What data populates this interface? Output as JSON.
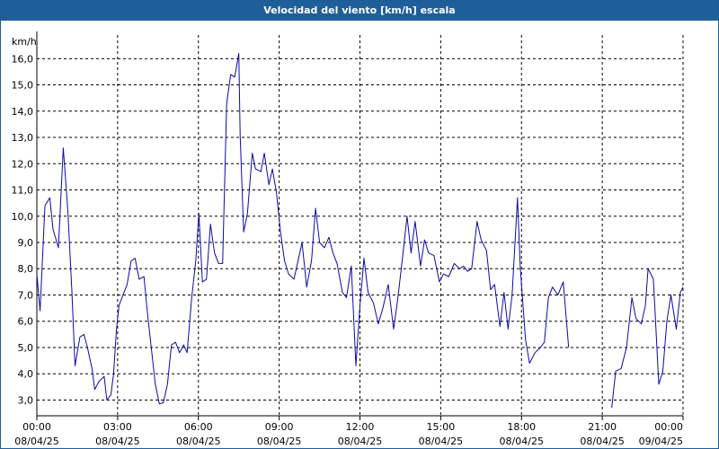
{
  "window": {
    "title": "Velocidad del viento [km/h] escala"
  },
  "chart_data": {
    "type": "line",
    "title": "Velocidad del viento [km/h] escala",
    "ylabel": "km/h",
    "xlabel": "",
    "ylim": [
      2.4,
      16.9
    ],
    "xlim": [
      0,
      24
    ],
    "grid": true,
    "y_ticks": [
      {
        "value": 3.0,
        "label": "3,0"
      },
      {
        "value": 4.0,
        "label": "4,0"
      },
      {
        "value": 5.0,
        "label": "5,0"
      },
      {
        "value": 6.0,
        "label": "6,0"
      },
      {
        "value": 7.0,
        "label": "7,0"
      },
      {
        "value": 8.0,
        "label": "8,0"
      },
      {
        "value": 9.0,
        "label": "9,0"
      },
      {
        "value": 10.0,
        "label": "10,0"
      },
      {
        "value": 11.0,
        "label": "11,0"
      },
      {
        "value": 12.0,
        "label": "12,0"
      },
      {
        "value": 13.0,
        "label": "13,0"
      },
      {
        "value": 14.0,
        "label": "14,0"
      },
      {
        "value": 15.0,
        "label": "15,0"
      },
      {
        "value": 16.0,
        "label": "16,0"
      }
    ],
    "x_ticks": [
      {
        "value": 0,
        "time": "00:00",
        "date": "08/04/25"
      },
      {
        "value": 3,
        "time": "03:00",
        "date": "08/04/25"
      },
      {
        "value": 6,
        "time": "06:00",
        "date": "08/04/25"
      },
      {
        "value": 9,
        "time": "09:00",
        "date": "08/04/25"
      },
      {
        "value": 12,
        "time": "12:00",
        "date": "08/04/25"
      },
      {
        "value": 15,
        "time": "15:00",
        "date": "08/04/25"
      },
      {
        "value": 18,
        "time": "18:00",
        "date": "08/04/25"
      },
      {
        "value": 21,
        "time": "21:00",
        "date": "08/04/25"
      },
      {
        "value": 24,
        "time": "00:00",
        "date": "09/04/25"
      }
    ],
    "series": [
      {
        "color": "#0a0aa8",
        "segments": [
          [
            [
              0.0,
              7.8
            ],
            [
              0.12,
              6.4
            ],
            [
              0.3,
              10.4
            ],
            [
              0.48,
              10.7
            ],
            [
              0.6,
              9.5
            ],
            [
              0.8,
              8.8
            ],
            [
              0.98,
              12.6
            ],
            [
              1.15,
              10.2
            ],
            [
              1.3,
              7.2
            ],
            [
              1.42,
              4.3
            ],
            [
              1.6,
              5.4
            ],
            [
              1.75,
              5.5
            ],
            [
              1.88,
              5.0
            ],
            [
              2.05,
              4.2
            ],
            [
              2.15,
              3.4
            ],
            [
              2.3,
              3.7
            ],
            [
              2.5,
              3.9
            ],
            [
              2.6,
              3.0
            ],
            [
              2.75,
              3.2
            ],
            [
              2.85,
              4.0
            ],
            [
              2.95,
              5.6
            ],
            [
              3.05,
              6.6
            ],
            [
              3.2,
              7.0
            ],
            [
              3.35,
              7.4
            ],
            [
              3.5,
              8.3
            ],
            [
              3.65,
              8.4
            ],
            [
              3.8,
              7.6
            ],
            [
              3.98,
              7.7
            ],
            [
              4.1,
              6.4
            ],
            [
              4.25,
              5.0
            ],
            [
              4.4,
              3.6
            ],
            [
              4.55,
              2.85
            ],
            [
              4.7,
              2.9
            ],
            [
              4.85,
              3.6
            ],
            [
              5.0,
              5.1
            ],
            [
              5.15,
              5.2
            ],
            [
              5.3,
              4.8
            ],
            [
              5.45,
              5.1
            ],
            [
              5.58,
              4.8
            ],
            [
              5.75,
              6.9
            ],
            [
              5.9,
              8.3
            ],
            [
              6.02,
              10.1
            ],
            [
              6.15,
              7.5
            ],
            [
              6.3,
              7.6
            ],
            [
              6.45,
              9.7
            ],
            [
              6.6,
              8.6
            ],
            [
              6.75,
              8.2
            ],
            [
              6.9,
              8.2
            ],
            [
              7.05,
              14.3
            ],
            [
              7.2,
              15.4
            ],
            [
              7.35,
              15.3
            ],
            [
              7.5,
              16.2
            ],
            [
              7.55,
              13.1
            ],
            [
              7.68,
              9.4
            ],
            [
              7.82,
              10.1
            ],
            [
              8.0,
              12.4
            ],
            [
              8.12,
              11.8
            ],
            [
              8.32,
              11.7
            ],
            [
              8.45,
              12.4
            ],
            [
              8.62,
              11.2
            ],
            [
              8.75,
              11.8
            ],
            [
              8.9,
              10.9
            ],
            [
              9.05,
              9.4
            ],
            [
              9.2,
              8.3
            ],
            [
              9.35,
              7.8
            ],
            [
              9.55,
              7.6
            ],
            [
              9.7,
              8.3
            ],
            [
              9.85,
              9.0
            ],
            [
              10.02,
              7.3
            ],
            [
              10.2,
              8.3
            ],
            [
              10.35,
              10.3
            ],
            [
              10.5,
              9.0
            ],
            [
              10.68,
              8.8
            ],
            [
              10.85,
              9.2
            ],
            [
              11.0,
              8.6
            ],
            [
              11.15,
              8.2
            ],
            [
              11.35,
              7.1
            ],
            [
              11.5,
              6.9
            ],
            [
              11.68,
              8.1
            ],
            [
              11.85,
              4.3
            ],
            [
              12.0,
              6.6
            ],
            [
              12.15,
              8.4
            ],
            [
              12.3,
              7.1
            ],
            [
              12.5,
              6.7
            ],
            [
              12.68,
              5.9
            ],
            [
              12.85,
              6.5
            ],
            [
              13.05,
              7.4
            ],
            [
              13.25,
              5.7
            ],
            [
              13.4,
              6.8
            ],
            [
              13.58,
              8.4
            ],
            [
              13.75,
              10.0
            ],
            [
              13.9,
              8.6
            ],
            [
              14.05,
              9.8
            ],
            [
              14.25,
              8.1
            ],
            [
              14.4,
              9.1
            ],
            [
              14.55,
              8.6
            ],
            [
              14.75,
              8.5
            ],
            [
              14.95,
              7.5
            ],
            [
              15.1,
              7.8
            ],
            [
              15.3,
              7.7
            ],
            [
              15.5,
              8.2
            ],
            [
              15.7,
              8.0
            ],
            [
              15.85,
              8.1
            ],
            [
              16.0,
              7.9
            ],
            [
              16.15,
              8.0
            ],
            [
              16.35,
              9.8
            ],
            [
              16.5,
              9.1
            ],
            [
              16.7,
              8.7
            ],
            [
              16.85,
              7.2
            ],
            [
              17.0,
              7.4
            ],
            [
              17.2,
              5.8
            ],
            [
              17.35,
              7.1
            ],
            [
              17.5,
              5.7
            ],
            [
              17.65,
              7.0
            ],
            [
              17.85,
              10.7
            ],
            [
              17.95,
              8.1
            ],
            [
              18.15,
              5.3
            ],
            [
              18.3,
              4.4
            ],
            [
              18.5,
              4.8
            ],
            [
              18.7,
              5.0
            ],
            [
              18.85,
              5.2
            ],
            [
              19.0,
              6.9
            ],
            [
              19.15,
              7.3
            ],
            [
              19.35,
              7.0
            ],
            [
              19.55,
              7.5
            ],
            [
              19.75,
              5.0
            ]
          ],
          [
            [
              21.35,
              2.7
            ],
            [
              21.5,
              4.1
            ],
            [
              21.7,
              4.2
            ],
            [
              21.9,
              5.0
            ],
            [
              22.1,
              6.9
            ],
            [
              22.25,
              6.1
            ],
            [
              22.45,
              5.9
            ],
            [
              22.6,
              6.6
            ],
            [
              22.7,
              8.0
            ],
            [
              22.9,
              7.6
            ],
            [
              23.1,
              3.6
            ],
            [
              23.25,
              4.1
            ],
            [
              23.4,
              6.0
            ],
            [
              23.55,
              7.0
            ],
            [
              23.75,
              5.7
            ],
            [
              23.9,
              7.1
            ],
            [
              24.0,
              7.3
            ]
          ]
        ]
      }
    ]
  }
}
